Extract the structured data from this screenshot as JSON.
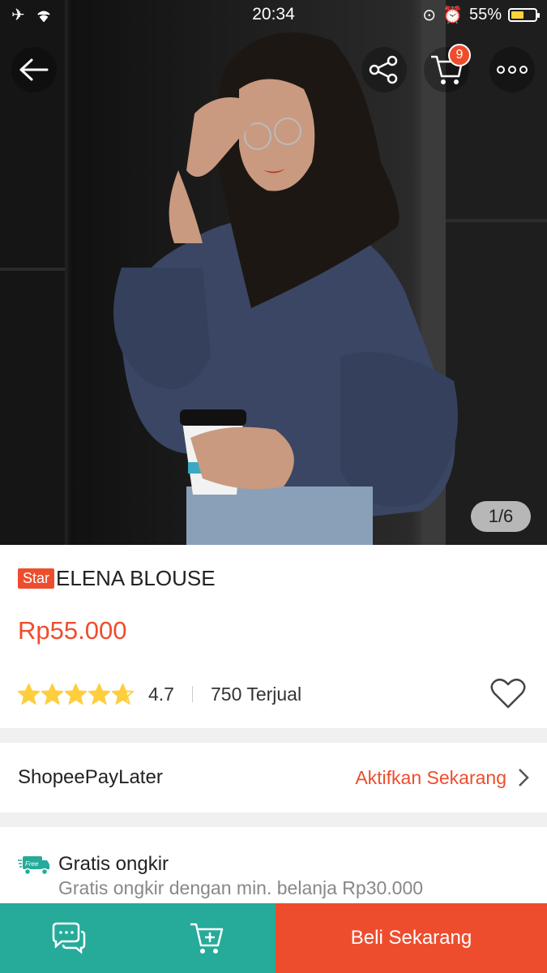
{
  "status_bar": {
    "time": "20:34",
    "battery": "55%",
    "battery_level": 0.55
  },
  "gallery": {
    "counter": "1/6"
  },
  "header": {
    "cart_count": "9"
  },
  "product": {
    "badge": "Star",
    "name": "ELENA BLOUSE",
    "price": "Rp55.000",
    "rating": "4.7",
    "rating_value": 4.7,
    "sold": "750 Terjual"
  },
  "paylater": {
    "label": "ShopeePayLater",
    "action": "Aktifkan Sekarang"
  },
  "shipping": {
    "icon_text": "Free",
    "title": "Gratis ongkir",
    "subtitle": "Gratis ongkir dengan min. belanja Rp30.000"
  },
  "bottom_bar": {
    "buy_label": "Beli Sekarang"
  },
  "colors": {
    "brand": "#ee4d2d",
    "teal": "#26aa99",
    "star": "#ffce3d"
  },
  "icons": [
    "back-arrow-icon",
    "share-icon",
    "cart-icon",
    "more-icon",
    "heart-icon",
    "chevron-right-icon",
    "free-shipping-truck-icon",
    "chat-icon",
    "add-to-cart-icon"
  ]
}
